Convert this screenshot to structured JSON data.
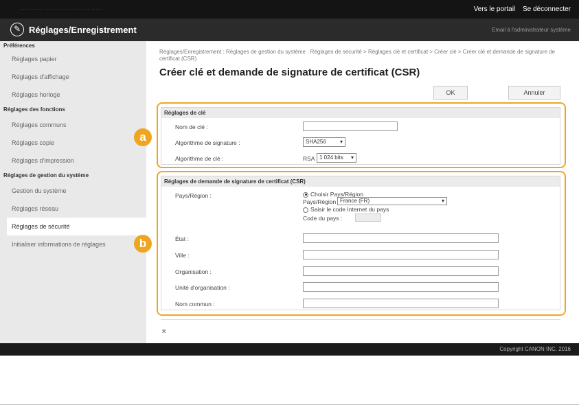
{
  "topbar": {
    "blurred_text": "··········  ·········· ·········· ·····",
    "portal_link": "Vers le portail",
    "logout_link": "Se déconnecter"
  },
  "titlebar": {
    "title": "Réglages/Enregistrement",
    "email": "Email à l'administrateur système"
  },
  "sidebar": {
    "groups": [
      {
        "label": "Préférences",
        "items": [
          "Réglages papier",
          "Réglages d'affichage",
          "Réglages horloge"
        ]
      },
      {
        "label": "Réglages des fonctions",
        "items": [
          "Réglages communs",
          "Réglages copie",
          "Réglages d'impression"
        ]
      },
      {
        "label": "Réglages de gestion du système",
        "items": [
          "Gestion du système",
          "Réglages réseau",
          "Réglages de sécurité",
          "Initialiser informations de réglages"
        ]
      }
    ]
  },
  "breadcrumb": "Réglages/Enregistrement : Réglages de gestion du système : Réglages de sécurité > Réglages clé et certificat > Créer clé > Créer clé et demande de signature de certificat (CSR)",
  "page_title": "Créer clé et demande de signature de certificat (CSR)",
  "buttons": {
    "ok": "OK",
    "cancel": "Annuler"
  },
  "key_settings": {
    "header": "Réglages de clé",
    "key_name_label": "Nom de clé :",
    "key_name_value": "",
    "sig_algo_label": "Algorithme de signature :",
    "sig_algo_value": "SHA256",
    "key_algo_label": "Algorithme de clé :",
    "key_algo_prefix": "RSA",
    "key_algo_value": "1 024 bits"
  },
  "csr_settings": {
    "header": "Réglages de demande de signature de certificat (CSR)",
    "country_label": "Pays/Région :",
    "choose_country": "Choisir Pays/Région",
    "country_select_label": "Pays/Région :",
    "country_select_value": "France (FR)",
    "enter_code": "Saisir le code Internet du pays",
    "country_code_label": "Code du pays :",
    "state_label": "État :",
    "city_label": "Ville :",
    "org_label": "Organisation :",
    "org_unit_label": "Unité d'organisation :",
    "common_name_label": "Nom commun :"
  },
  "callouts": {
    "a": "a",
    "b": "b"
  },
  "to_top_glyph": "⌅",
  "footer": {
    "copyright": "Copyright CANON INC. 2016"
  },
  "accent_color": "#f0a520"
}
